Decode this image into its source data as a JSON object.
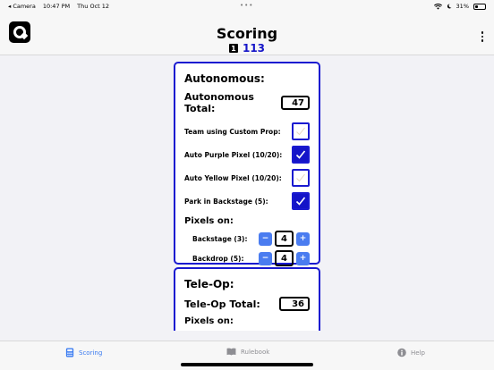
{
  "status_bar": {
    "back_app": "◂ Camera",
    "time": "10:47 PM",
    "date": "Thu Oct 12",
    "battery": "31%",
    "battery_level": 0.31
  },
  "header": {
    "title": "Scoring",
    "team_badge": "1",
    "team_number": "113"
  },
  "autonomous": {
    "heading": "Autonomous:",
    "total_label": "Autonomous Total:",
    "total_value": "47",
    "checks": [
      {
        "label": "Team using Custom Prop:",
        "checked": false
      },
      {
        "label": "Auto Purple Pixel (10/20):",
        "checked": true
      },
      {
        "label": "Auto Yellow Pixel (10/20):",
        "checked": false
      },
      {
        "label": "Park in Backstage (5):",
        "checked": true
      }
    ],
    "pixels_label": "Pixels on:",
    "steppers": [
      {
        "label": "Backstage (3):",
        "value": "4",
        "minus": "−",
        "plus": "+"
      },
      {
        "label": "Backdrop (5):",
        "value": "4",
        "minus": "−",
        "plus": "+"
      }
    ]
  },
  "teleop": {
    "heading": "Tele-Op:",
    "total_label": "Tele-Op Total:",
    "total_value": "36",
    "pixels_label": "Pixels on:"
  },
  "tabs": [
    {
      "label": "Scoring",
      "icon": "calculator-icon",
      "active": true
    },
    {
      "label": "Rulebook",
      "icon": "book-icon",
      "active": false
    },
    {
      "label": "Help",
      "icon": "info-icon",
      "active": false
    }
  ],
  "colors": {
    "accent_blue": "#1a1ad0",
    "tab_active": "#3a7bf0",
    "stepper_blue": "#4a7cf0",
    "team_number": "#1515c8"
  }
}
